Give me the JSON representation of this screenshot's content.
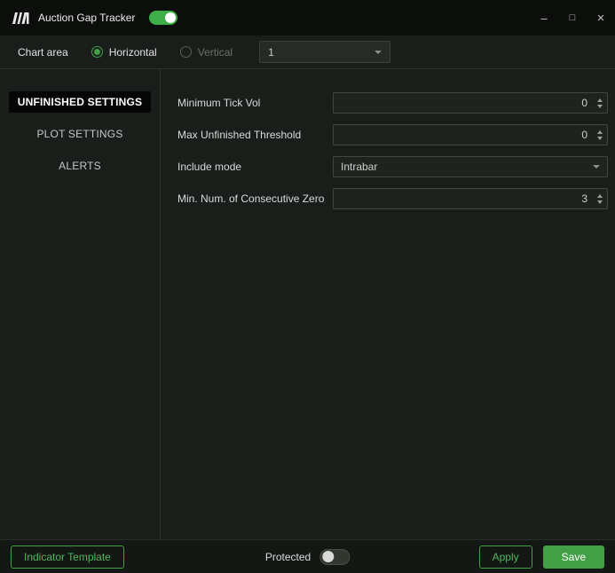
{
  "titlebar": {
    "title": "Auction Gap Tracker",
    "minimize_glyph": "–",
    "maximize_glyph": "□",
    "close_glyph": "×"
  },
  "toolbar": {
    "chart_area_label": "Chart area",
    "horizontal_label": "Horizontal",
    "vertical_label": "Vertical",
    "chart_number_value": "1"
  },
  "sidebar": {
    "items": [
      {
        "label": "UNFINISHED SETTINGS",
        "selected": true
      },
      {
        "label": "PLOT SETTINGS",
        "selected": false
      },
      {
        "label": "ALERTS",
        "selected": false
      }
    ]
  },
  "form": {
    "fields": [
      {
        "label": "Minimum Tick Vol",
        "value": "0",
        "type": "number"
      },
      {
        "label": "Max Unfinished Threshold",
        "value": "0",
        "type": "number"
      },
      {
        "label": "Include mode",
        "value": "Intrabar",
        "type": "select"
      },
      {
        "label": "Min. Num. of Consecutive Zero",
        "value": "3",
        "type": "number"
      }
    ]
  },
  "footer": {
    "indicator_template_label": "Indicator Template",
    "protected_label": "Protected",
    "apply_label": "Apply",
    "save_label": "Save"
  },
  "state": {
    "indicator_enabled": true,
    "protected_enabled": false,
    "chart_orientation": "Horizontal",
    "selected_tab": "UNFINISHED SETTINGS"
  },
  "colors": {
    "accent_green": "#43a047",
    "toggle_green": "#3fae49",
    "selected_tab_bg": "#060606",
    "window_bg": "#1a1e1a",
    "titlebar_bg": "#0b0e0b"
  }
}
